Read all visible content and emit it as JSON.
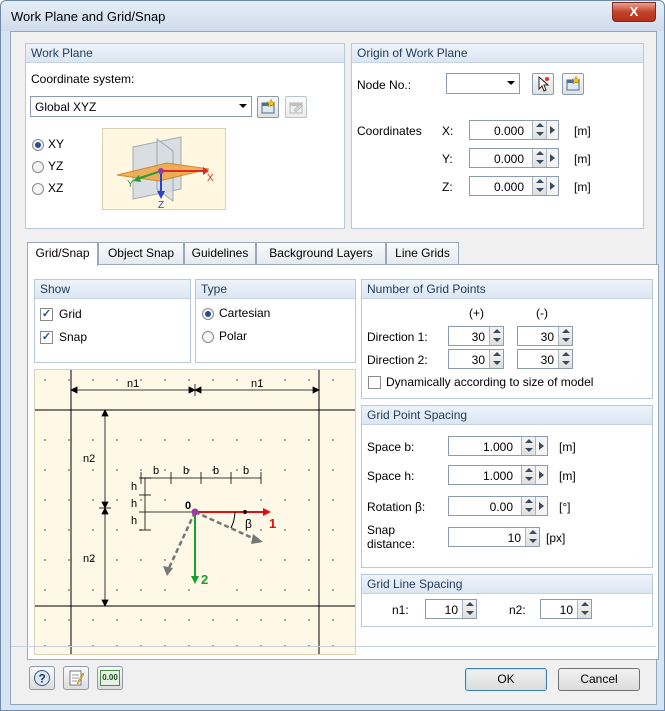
{
  "window": {
    "title": "Work Plane and Grid/Snap",
    "close_label": "X"
  },
  "work_plane": {
    "header": "Work Plane",
    "coord_label": "Coordinate system:",
    "coord_value": "Global XYZ",
    "planes": [
      {
        "label": "XY",
        "selected": true
      },
      {
        "label": "YZ",
        "selected": false
      },
      {
        "label": "XZ",
        "selected": false
      }
    ]
  },
  "origin": {
    "header": "Origin of Work Plane",
    "node_label": "Node No.:",
    "node_value": "",
    "coordinates_label": "Coordinates",
    "rows": [
      {
        "axis": "X:",
        "value": "0.000",
        "unit": "[m]"
      },
      {
        "axis": "Y:",
        "value": "0.000",
        "unit": "[m]"
      },
      {
        "axis": "Z:",
        "value": "0.000",
        "unit": "[m]"
      }
    ]
  },
  "tabs": [
    "Grid/Snap",
    "Object Snap",
    "Guidelines",
    "Background Layers",
    "Line Grids"
  ],
  "show": {
    "header": "Show",
    "items": [
      {
        "label": "Grid",
        "checked": true
      },
      {
        "label": "Snap",
        "checked": true
      }
    ]
  },
  "type": {
    "header": "Type",
    "items": [
      {
        "label": "Cartesian",
        "selected": true
      },
      {
        "label": "Polar",
        "selected": false
      }
    ]
  },
  "grid_points": {
    "header": "Number of Grid Points",
    "plus_label": "(+)",
    "minus_label": "(-)",
    "dir1_label": "Direction 1:",
    "dir1_plus": "30",
    "dir1_minus": "30",
    "dir2_label": "Direction 2:",
    "dir2_plus": "30",
    "dir2_minus": "30",
    "dynamic_label": "Dynamically according to size of model",
    "dynamic_checked": false
  },
  "spacing": {
    "header": "Grid Point Spacing",
    "b_label": "Space b:",
    "b_value": "1.000",
    "b_unit": "[m]",
    "h_label": "Space h:",
    "h_value": "1.000",
    "h_unit": "[m]",
    "rot_label": "Rotation β:",
    "rot_value": "0.00",
    "rot_unit": "[°]",
    "snap_label_1": "Snap",
    "snap_label_2": "distance:",
    "snap_value": "10",
    "snap_unit": "[px]"
  },
  "line_spacing": {
    "header": "Grid Line Spacing",
    "n1_label": "n1:",
    "n1_value": "10",
    "n2_label": "n2:",
    "n2_value": "10"
  },
  "diagram": {
    "n1": "n1",
    "n2": "n2",
    "b": "b",
    "h": "h",
    "origin": "0",
    "beta": "β",
    "axis1": "1",
    "axis2": "2",
    "icon_x": "X",
    "icon_y": "Y",
    "icon_z": "Z"
  },
  "footer": {
    "ok": "OK",
    "cancel": "Cancel",
    "num_icon": "0.00"
  }
}
